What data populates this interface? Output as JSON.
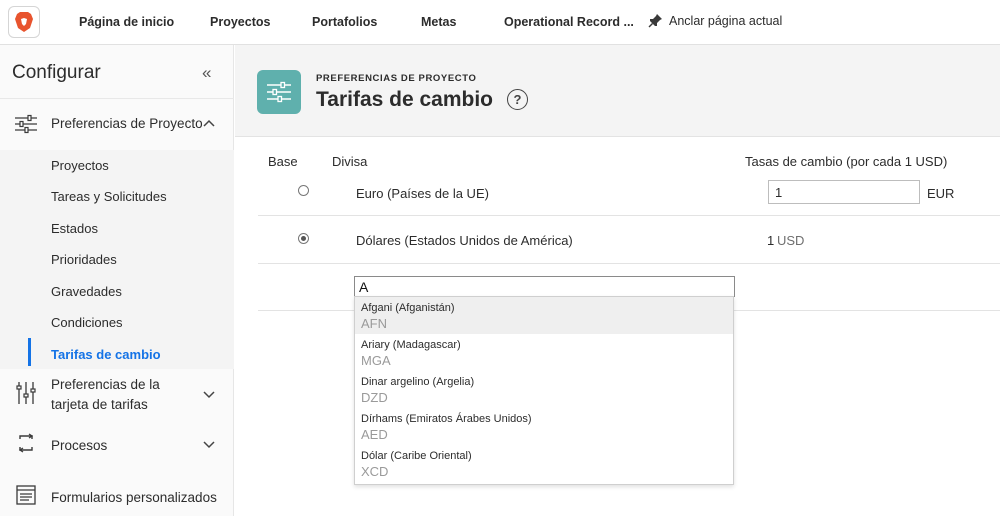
{
  "topnav": {
    "items": [
      "Página de inicio",
      "Proyectos",
      "Portafolios",
      "Metas",
      "Operational Record ..."
    ],
    "pin_label": "Anclar página actual"
  },
  "sidebar": {
    "title": "Configurar",
    "sections": [
      {
        "label": "Preferencias de Proyecto",
        "icon": "sliders-icon",
        "expanded": true
      },
      {
        "label": "Preferencias de la tarjeta de tarifas",
        "icon": "vertical-sliders-icon",
        "expanded": false
      },
      {
        "label": "Procesos",
        "icon": "process-cycle-icon",
        "expanded": false
      },
      {
        "label": "Formularios personalizados",
        "icon": "form-icon",
        "expanded": false
      }
    ],
    "sub_items": [
      "Proyectos",
      "Tareas y Solicitudes",
      "Estados",
      "Prioridades",
      "Gravedades",
      "Condiciones",
      "Tarifas de cambio"
    ],
    "active_sub_item": "Tarifas de cambio"
  },
  "header": {
    "eyebrow": "PREFERENCIAS DE PROYECTO",
    "title": "Tarifas de cambio",
    "help": "?"
  },
  "table": {
    "columns": {
      "base": "Base",
      "currency": "Divisa",
      "rates": "Tasas de cambio (por cada 1 USD)"
    },
    "rows": [
      {
        "base_selected": false,
        "currency": "Euro (Países de la UE)",
        "rate": "1",
        "code": "EUR"
      },
      {
        "base_selected": true,
        "currency": "Dólares (Estados Unidos de América)",
        "rate": "1",
        "code": "USD"
      }
    ]
  },
  "currency_search": {
    "value": "A",
    "options": [
      {
        "name": "Afgani (Afganistán)",
        "code": "AFN",
        "highlighted": true
      },
      {
        "name": "Ariary (Madagascar)",
        "code": "MGA",
        "highlighted": false
      },
      {
        "name": "Dinar argelino (Argelia)",
        "code": "DZD",
        "highlighted": false
      },
      {
        "name": "Dírhams (Emiratos Árabes Unidos)",
        "code": "AED",
        "highlighted": false
      },
      {
        "name": "Dólar (Caribe Oriental)",
        "code": "XCD",
        "highlighted": false
      }
    ]
  },
  "colors": {
    "accent": "#1473e6",
    "page_icon_bg": "#5fb0ad",
    "logo": "#e8542e"
  }
}
